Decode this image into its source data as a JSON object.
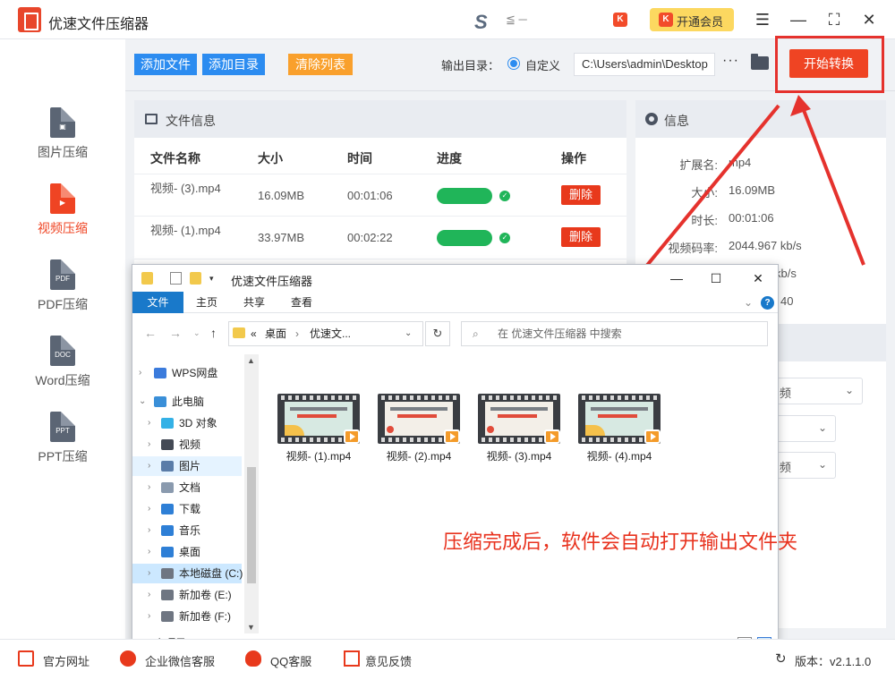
{
  "app": {
    "title": "优速文件压缩器",
    "user_mark": "S",
    "user_name": "≦ ─",
    "vip_badge": "K",
    "vip_label": "开通会员"
  },
  "window_controls": {
    "menu": "☰",
    "minimize": "—",
    "maximize": "⛶",
    "close": "✕"
  },
  "sidebar": {
    "items": [
      {
        "label": "图片压缩",
        "icon": "image-doc-icon",
        "badge": "▣",
        "active": false
      },
      {
        "label": "视频压缩",
        "icon": "video-doc-icon",
        "badge": "▶",
        "active": true
      },
      {
        "label": "PDF压缩",
        "icon": "pdf-doc-icon",
        "badge": "PDF",
        "active": false
      },
      {
        "label": "Word压缩",
        "icon": "doc-doc-icon",
        "badge": "DOC",
        "active": false
      },
      {
        "label": "PPT压缩",
        "icon": "ppt-doc-icon",
        "badge": "PPT",
        "active": false
      }
    ]
  },
  "toolbar": {
    "add_file": "添加文件",
    "add_dir": "添加目录",
    "clear_list": "清除列表",
    "output_label": "输出目录：",
    "radio_label": "自定义",
    "output_path": "C:\\Users\\admin\\Desktop",
    "more": "···",
    "start": "开始转换"
  },
  "file_panel": {
    "title": "文件信息",
    "columns": [
      "文件名称",
      "大小",
      "时间",
      "进度",
      "操作"
    ],
    "rows": [
      {
        "name": "视频- (3).mp4",
        "size": "16.09MB",
        "time": "00:01:06",
        "progress": 1.0,
        "action": "删除"
      },
      {
        "name": "视频- (1).mp4",
        "size": "33.97MB",
        "time": "00:02:22",
        "progress": 1.0,
        "action": "删除"
      }
    ]
  },
  "info_panel": {
    "title": "信息",
    "fields": [
      {
        "key": "扩展名:",
        "value": "mp4"
      },
      {
        "key": "大小:",
        "value": "16.09MB"
      },
      {
        "key": "时长:",
        "value": "00:01:06"
      },
      {
        "key": "视频码率:",
        "value": "2044.967 kb/s"
      },
      {
        "key": "",
        "value": "kb/s"
      },
      {
        "key": "",
        "value": "40"
      }
    ],
    "selects": [
      "频",
      "",
      "频"
    ]
  },
  "explorer": {
    "title": "优速文件压缩器",
    "controls": {
      "minimize": "—",
      "maximize": "☐",
      "close": "✕"
    },
    "ribbon_tabs": [
      "文件",
      "主页",
      "共享",
      "查看"
    ],
    "help": "?",
    "address": {
      "prefix": "«",
      "part1": "桌面",
      "sep": "›",
      "part2": "优速文..."
    },
    "search_placeholder": "在 优速文件压缩器 中搜索",
    "nav": [
      {
        "label": "WPS网盘",
        "icon": "cloud-icon",
        "color": "#3b7bdc",
        "indent": 0
      },
      {
        "label": "此电脑",
        "icon": "computer-icon",
        "color": "#3a8fd8",
        "indent": 0
      },
      {
        "label": "3D 对象",
        "icon": "3d-objects-icon",
        "color": "#34b1e6",
        "indent": 1
      },
      {
        "label": "视频",
        "icon": "video-folder-icon",
        "color": "#444a55",
        "indent": 1
      },
      {
        "label": "图片",
        "icon": "pictures-folder-icon",
        "color": "#5a7ca8",
        "indent": 1
      },
      {
        "label": "文档",
        "icon": "documents-folder-icon",
        "color": "#8a9aae",
        "indent": 1
      },
      {
        "label": "下载",
        "icon": "download-icon",
        "color": "#2e7fd6",
        "indent": 1
      },
      {
        "label": "音乐",
        "icon": "music-icon",
        "color": "#2e7fd6",
        "indent": 1
      },
      {
        "label": "桌面",
        "icon": "desktop-folder-icon",
        "color": "#2e7fd6",
        "indent": 1
      },
      {
        "label": "本地磁盘 (C:)",
        "icon": "drive-c-icon",
        "color": "#6f7682",
        "indent": 1
      },
      {
        "label": "新加卷 (E:)",
        "icon": "drive-e-icon",
        "color": "#6f7682",
        "indent": 1
      },
      {
        "label": "新加卷 (F:)",
        "icon": "drive-f-icon",
        "color": "#6f7682",
        "indent": 1
      }
    ],
    "files": [
      {
        "name": "视频- (1).mp4",
        "style": "a"
      },
      {
        "name": "视频- (2).mp4",
        "style": "b"
      },
      {
        "name": "视频- (3).mp4",
        "style": "b"
      },
      {
        "name": "视频- (4).mp4",
        "style": "a"
      }
    ],
    "annotation": "压缩完成后，软件会自动打开输出文件夹",
    "status": "4 个项目"
  },
  "footer": {
    "links": [
      "官方网址",
      "企业微信客服",
      "QQ客服",
      "意见反馈"
    ],
    "version": "版本：v2.1.1.0"
  },
  "colors": {
    "accent": "#ef4423",
    "primary_blue": "#2c8cf0",
    "success": "#20b559",
    "annotation": "#e5322d"
  }
}
